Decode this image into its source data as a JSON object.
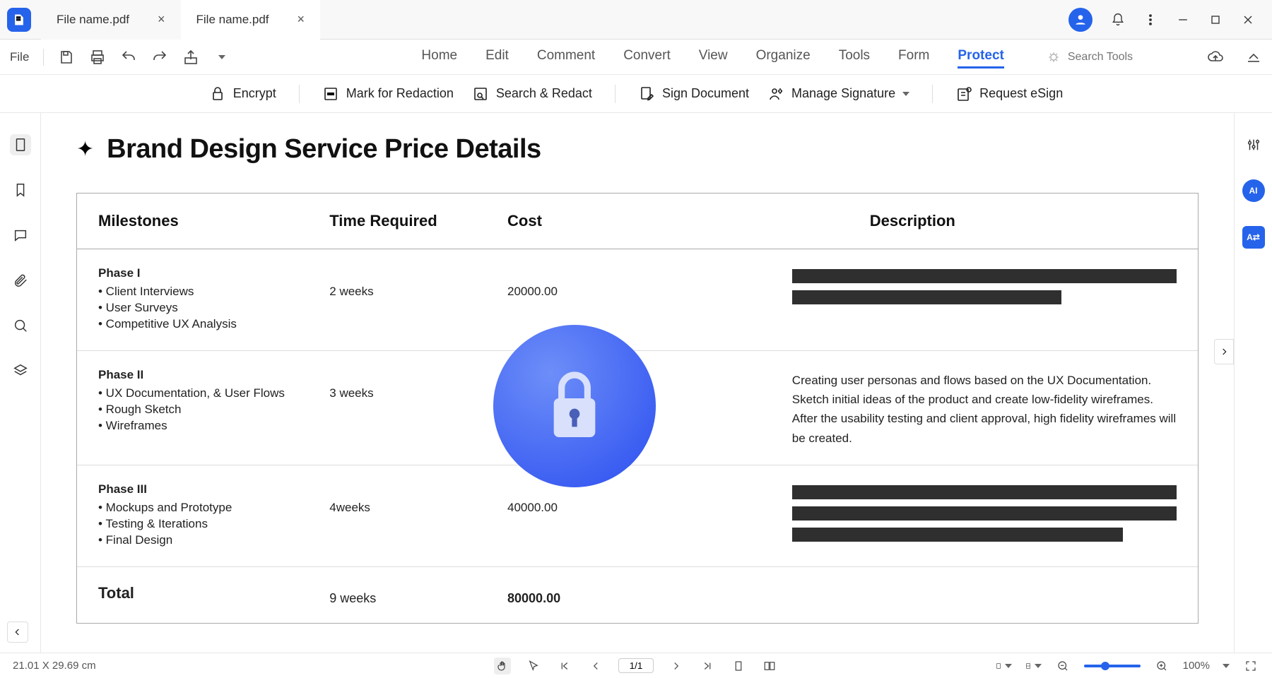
{
  "tabs": [
    {
      "name": "File name.pdf",
      "active": false
    },
    {
      "name": "File name.pdf",
      "active": true
    }
  ],
  "toolbar1": {
    "file_label": "File",
    "search_placeholder": "Search Tools"
  },
  "menu_tabs": [
    "Home",
    "Edit",
    "Comment",
    "Convert",
    "View",
    "Organize",
    "Tools",
    "Form",
    "Protect"
  ],
  "menu_active": "Protect",
  "protect_tools": {
    "encrypt": "Encrypt",
    "mark_redaction": "Mark for Redaction",
    "search_redact": "Search & Redact",
    "sign_document": "Sign Document",
    "manage_signature": "Manage Signature",
    "request_esign": "Request eSign"
  },
  "document": {
    "title": "Brand Design Service Price Details",
    "headers": {
      "milestones": "Milestones",
      "time": "Time Required",
      "cost": "Cost",
      "description": "Description"
    },
    "rows": [
      {
        "phase": "Phase I",
        "bullets": [
          "Client Interviews",
          "User Surveys",
          "Competitive UX Analysis"
        ],
        "time": "2 weeks",
        "cost": "20000.00",
        "desc_type": "redacted",
        "redact_widths": [
          "100%",
          "70%"
        ]
      },
      {
        "phase": "Phase II",
        "bullets": [
          "UX Documentation, & User Flows",
          "Rough Sketch",
          "Wireframes"
        ],
        "time": "3 weeks",
        "cost": "",
        "desc_type": "text",
        "desc": "Creating user personas and flows based on the UX Documentation. Sketch initial ideas of the product and create low-fidelity wireframes. After the usability testing and client approval, high fidelity wireframes will be created."
      },
      {
        "phase": "Phase III",
        "bullets": [
          "Mockups and Prototype",
          "Testing & Iterations",
          "Final Design"
        ],
        "time": "4weeks",
        "cost": "40000.00",
        "desc_type": "redacted",
        "redact_widths": [
          "100%",
          "100%",
          "86%"
        ]
      }
    ],
    "total": {
      "label": "Total",
      "time": "9 weeks",
      "cost": "80000.00"
    }
  },
  "bottombar": {
    "dimensions": "21.01 X 29.69 cm",
    "page": "1/1",
    "zoom": "100%"
  }
}
